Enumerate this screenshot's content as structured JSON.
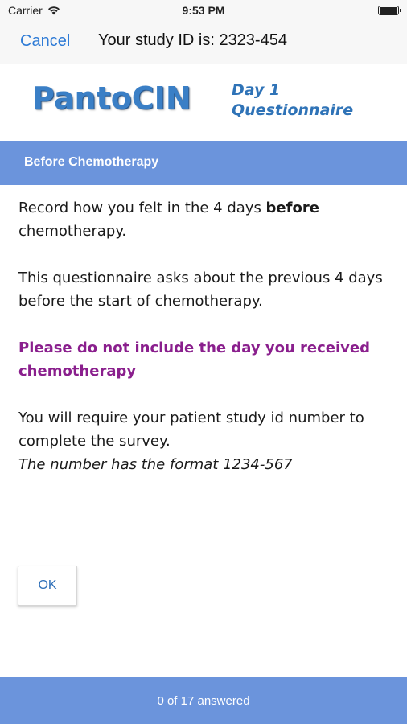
{
  "status_bar": {
    "carrier": "Carrier",
    "time": "9:53 PM",
    "icons": [
      "wifi-icon",
      "battery-icon"
    ]
  },
  "nav": {
    "cancel_label": "Cancel",
    "title": "Your study ID is: 2323-454"
  },
  "brand": {
    "logo_text": "PantoCIN",
    "day_line1": "Day 1",
    "day_line2": "Questionnaire"
  },
  "section": {
    "title": "Before Chemotherapy"
  },
  "content": {
    "para1_pre": "Record how you felt in the 4 days ",
    "para1_bold": "before",
    "para1_post": " chemotherapy.",
    "para2": "This questionnaire asks about the previous 4 days before the start of chemotherapy.",
    "warning": "Please do not include the day you received chemotherapy",
    "para3": "You will require your patient study id number to complete the survey.",
    "para3_italic": "The number has the format 1234-567"
  },
  "ok_label": "OK",
  "footer": {
    "progress_text": "0 of 17 answered",
    "answered": 0,
    "total": 17
  },
  "colors": {
    "accent": "#6b94dc",
    "link": "#2e7bd6",
    "warning": "#8a1f8d",
    "logo": "#3a7fc6"
  }
}
